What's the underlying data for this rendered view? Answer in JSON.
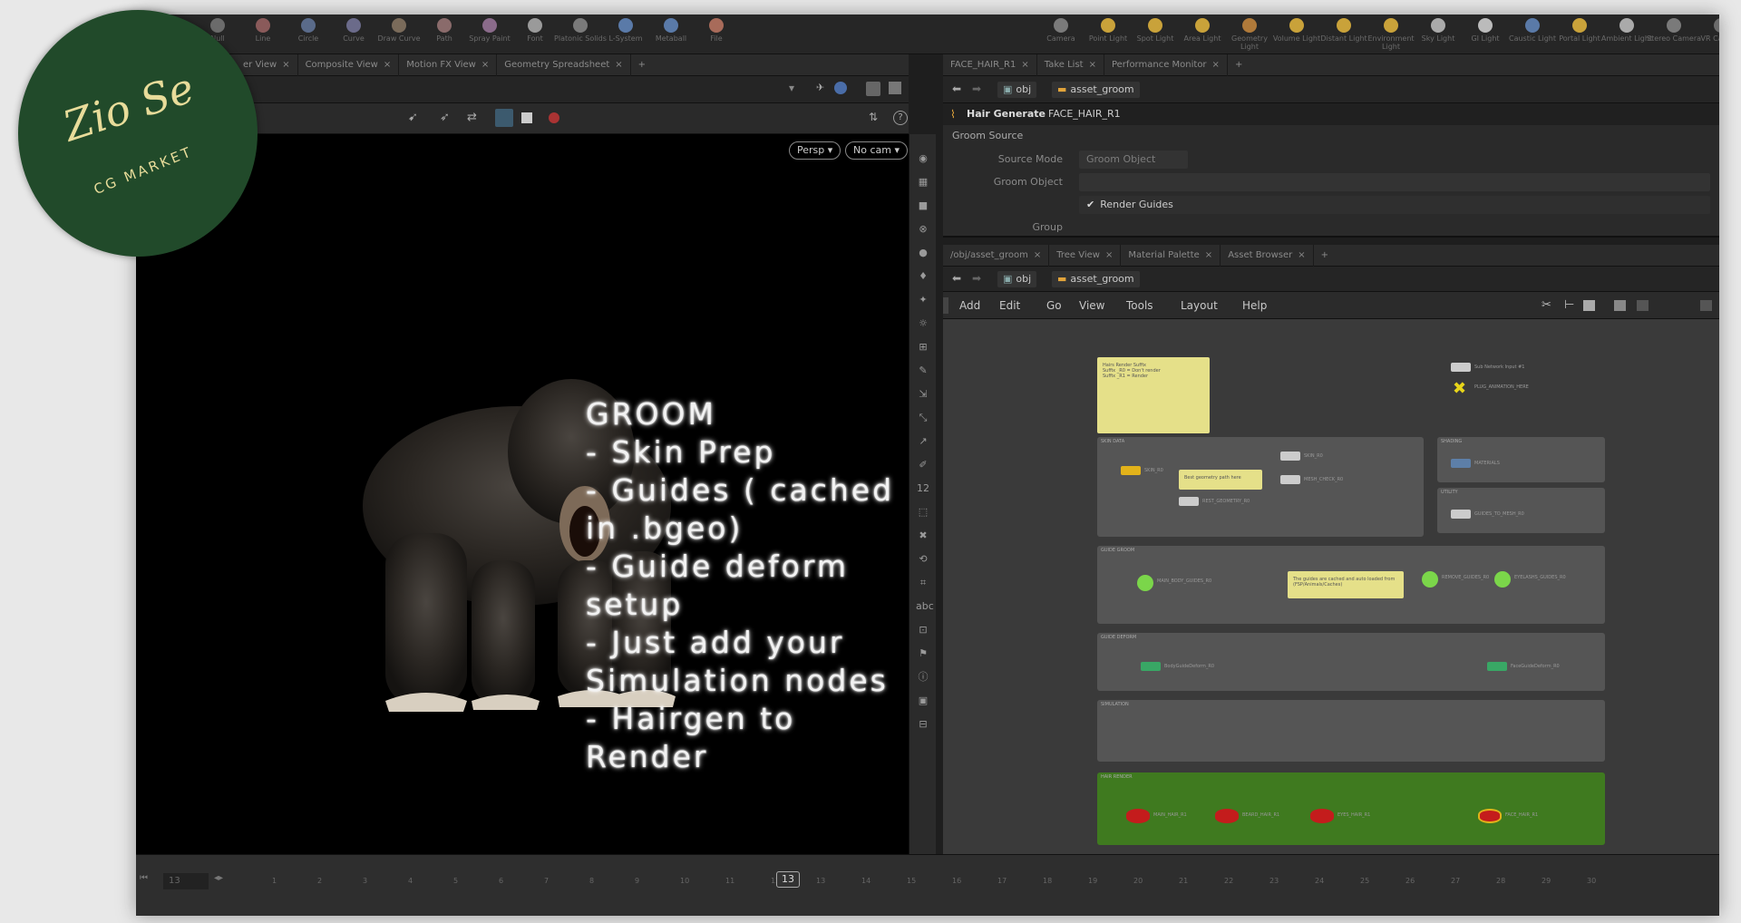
{
  "shelf": {
    "tools": [
      "Null",
      "Line",
      "Circle",
      "Curve",
      "Draw Curve",
      "Path",
      "Spray Paint",
      "Font",
      "Platonic Solids",
      "L-System",
      "Metaball",
      "File",
      "Camera",
      "Point Light",
      "Spot Light",
      "Area Light",
      "Geometry Light",
      "Volume Light",
      "Distant Light",
      "Environment Light",
      "Sky Light",
      "GI Light",
      "Caustic Light",
      "Portal Light",
      "Ambient Light",
      "Stereo Camera",
      "VR Camera"
    ]
  },
  "left_tabs": [
    "er View",
    "Composite View",
    "Motion FX View",
    "Geometry Spreadsheet"
  ],
  "viewport": {
    "persp_label": "Persp ▾",
    "cam_label": "No cam ▾",
    "overlay_title": "GROOM",
    "overlay_lines": [
      "- Skin Prep",
      "- Guides ( cached in .bgeo)",
      "- Guide deform setup",
      "- Just add your Simulation nodes",
      "- Hairgen to Render"
    ]
  },
  "right_tabs": [
    "FACE_HAIR_R1",
    "Take List",
    "Performance Monitor"
  ],
  "param_path": {
    "level1": "obj",
    "level2": "asset_groom"
  },
  "params": {
    "node_type": "Hair Generate",
    "node_name": "FACE_HAIR_R1",
    "section": "Groom Source",
    "source_mode_label": "Source Mode",
    "source_mode_value": "Groom Object",
    "groom_object_label": "Groom Object",
    "render_guides_label": "Render Guides",
    "group_label": "Group"
  },
  "network_tabs": [
    "/obj/asset_groom",
    "Tree View",
    "Material Palette",
    "Asset Browser"
  ],
  "network_path": {
    "level1": "obj",
    "level2": "asset_groom"
  },
  "network_menu": [
    "Add",
    "Edit",
    "Go",
    "View",
    "Tools",
    "Layout",
    "Help"
  ],
  "network": {
    "sticky_top": "Hairs Render Suffix\nSuffix _R0 = Don't render\nSuffix _R1 = Render",
    "box_skin": "SKIN DATA",
    "box_shading": "SHADING",
    "box_utility": "UTILITY",
    "box_guide": "GUIDE GROOM",
    "box_deform": "GUIDE DEFORM",
    "box_sim": "SIMULATION",
    "box_render": "HAIR RENDER",
    "sticky_geo": "Best geometry path here",
    "sticky_guides": "The guides are cached and auto loaded from (FSP/Animals/Caches)",
    "nodes": [
      "SKIN_R0",
      "REST_GEOMETRY_R0",
      "SKIN_R0",
      "MESH_CHECK_R0",
      "MATERIALS",
      "GUIDES_TO_MESH_R0",
      "MAIN_BODY_GUIDES_R0",
      "REMOVE_GUIDES_R0",
      "EYELASHS_GUIDES_R0",
      "BodyGuideDeform_R0",
      "FaceGuideDeform_R0",
      "MAIN_HAIR_R1",
      "BEARD_HAIR_R1",
      "EYES_HAIR_R1",
      "FACE_HAIR_R1",
      "Sub Network Input #1",
      "PLUG_ANIMATION_HERE"
    ]
  },
  "timeline": {
    "current_frame": "13",
    "frame_field": "13",
    "ticks": [
      "1",
      "2",
      "3",
      "4",
      "5",
      "6",
      "7",
      "8",
      "9",
      "10",
      "11",
      "12",
      "13",
      "14",
      "15",
      "16",
      "17",
      "18",
      "19",
      "20",
      "21",
      "22",
      "23",
      "24",
      "25",
      "26",
      "27",
      "28",
      "29",
      "30"
    ]
  },
  "logo": {
    "line1": "Zio Se",
    "line2": "CG MARKET"
  },
  "colors": {
    "sticky": "#e5e089",
    "render_box": "#3f7a1f",
    "red_node": "#c41c1c",
    "green_node": "#7bd64a",
    "yellow_node": "#e2b21a"
  }
}
